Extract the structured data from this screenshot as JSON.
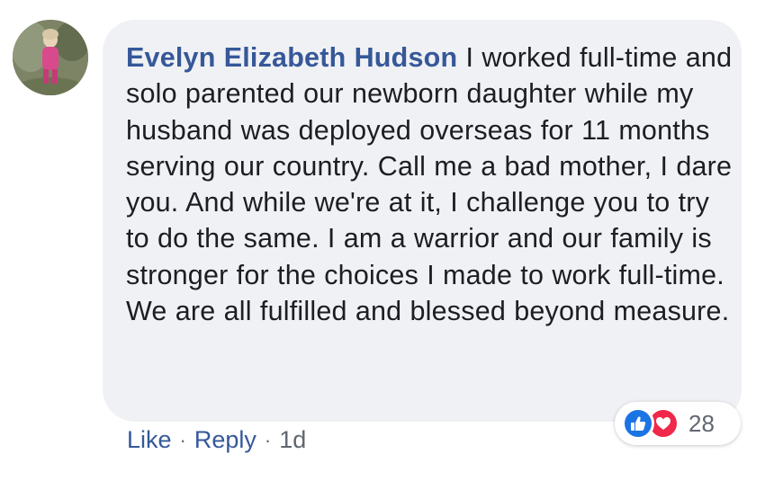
{
  "comment": {
    "author": "Evelyn Elizabeth Hudson",
    "text": "I worked full-time and solo parented our newborn daughter while my husband was deployed overseas for 11 months serving our country. Call me a bad mother, I dare you. And while we're at it, I challenge you to try to do the same. I am a warrior and our family is stronger for the choices I made to work full-time. We are all fulfilled and blessed beyond measure."
  },
  "reactions": {
    "icons": [
      "thumbs-up-icon",
      "heart-icon"
    ],
    "count": "28",
    "colors": {
      "like": "#1b74e4",
      "love": "#f0284a"
    }
  },
  "actions": {
    "like_label": "Like",
    "separator": "·",
    "reply_label": "Reply",
    "timestamp": "1d"
  },
  "colors": {
    "author_link": "#365899",
    "bubble_bg": "#f0f1f4",
    "body_text": "#1c1e21",
    "meta_text": "#606770"
  }
}
